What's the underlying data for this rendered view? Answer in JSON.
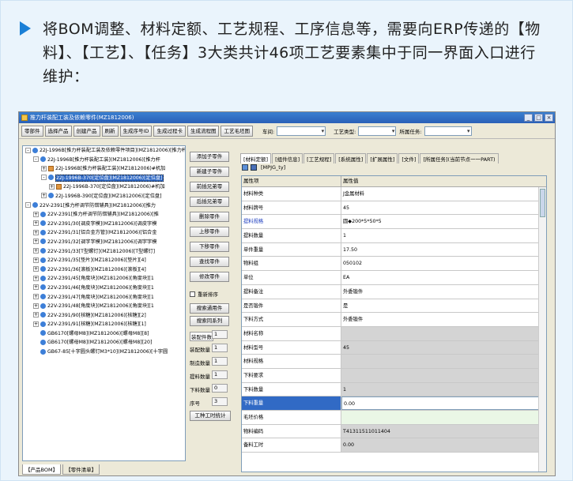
{
  "intro": {
    "text": "将BOM调整、材料定额、工艺规程、工序信息等，需要向ERP传递的【物料】、【工艺】、【任务】3大类共计46项工艺要素集中于同一界面入口进行维护："
  },
  "window": {
    "title": "推力杆装配工装及依赖零件(MZ1812006)",
    "controls": [
      "_",
      "□",
      "×"
    ]
  },
  "toolbar": {
    "buttons": [
      "零部件",
      "选择产品",
      "创建产品",
      "刷新",
      "生成序号ID",
      "生成过程卡",
      "生成流程图",
      "工艺毛坯图"
    ],
    "workshop_label": "车间:",
    "workshop_value": "",
    "process_type_label": "工艺类型:",
    "process_type_value": "",
    "task_label": "所属任务:",
    "task_value": ""
  },
  "tree": {
    "nodes": [
      {
        "text": "22J-1996B[推力杆装配工装及依赖零件项目](MZ1812006)[推力杆",
        "level": 0,
        "icon": "node",
        "exp": "-"
      },
      {
        "text": "22J-1996B[推力杆装配工装](MZ1812006)[推力杆",
        "level": 1,
        "icon": "node",
        "exp": "-"
      },
      {
        "text": "22J-1996B[推力杆装配工装](MZ1812006)#机加",
        "level": 2,
        "icon": "pkg",
        "exp": "+"
      },
      {
        "text": "22J-1996B-370[定位盘](MZ1812006)[定位盘]",
        "level": 2,
        "icon": "node",
        "exp": "-",
        "selected": true
      },
      {
        "text": "22J-1996B-370[定位盘](MZ1812006)#机加",
        "level": 3,
        "icon": "pkg",
        "exp": "+"
      },
      {
        "text": "22J-1996B-390[定位盘](MZ1812006)[定位盘]",
        "level": 2,
        "icon": "node",
        "exp": "+"
      },
      {
        "text": "22V-2391[推力杆调节防错辅具](MZ1812006)[推力",
        "level": 0,
        "icon": "node",
        "exp": "-"
      },
      {
        "text": "22V-2391[推力杆调节防错辅具](MZ1812006)[推",
        "level": 1,
        "icon": "node",
        "exp": "+"
      },
      {
        "text": "22V-2391/30[调皮字模](MZ1812006)[调皮字模",
        "level": 1,
        "icon": "node",
        "exp": "+"
      },
      {
        "text": "22V-2391/31[铝合金方管](MZ1812006)[铝合金",
        "level": 1,
        "icon": "node",
        "exp": "+"
      },
      {
        "text": "22V-2391/32[调字字模](MZ1812006)[调字字模",
        "level": 1,
        "icon": "node",
        "exp": "+"
      },
      {
        "text": "22V-2391/33[T型螺钉](MZ1812006)[T型螺钉]",
        "level": 1,
        "icon": "node",
        "exp": "+"
      },
      {
        "text": "22V-2391/35[垫片](MZ1812006)[垫片][4]",
        "level": 1,
        "icon": "node",
        "exp": "+"
      },
      {
        "text": "22V-2391/36[滚板](MZ1812006)[滚板][4]",
        "level": 1,
        "icon": "node",
        "exp": "+"
      },
      {
        "text": "22V-2391/45[角度块](MZ1812006)[角度块][1",
        "level": 1,
        "icon": "node",
        "exp": "+"
      },
      {
        "text": "22V-2391/46[角度块](MZ1812006)[角度块][1",
        "level": 1,
        "icon": "node",
        "exp": "+"
      },
      {
        "text": "22V-2391/47[角度块](MZ1812006)[角度块][1",
        "level": 1,
        "icon": "node",
        "exp": "+"
      },
      {
        "text": "22V-2391/48[角度块](MZ1812006)[角度块][1",
        "level": 1,
        "icon": "node",
        "exp": "+"
      },
      {
        "text": "22V-2391/90[核糖](MZ1812006)[核糖][2]",
        "level": 1,
        "icon": "node",
        "exp": "+"
      },
      {
        "text": "22V-2391/91[核糖](MZ1812006)[核糖][1]",
        "level": 1,
        "icon": "node",
        "exp": "+"
      },
      {
        "text": "GB6170[螺母M8](MZ1812006)[螺母M8][8]",
        "level": 1,
        "icon": "node",
        "exp": ""
      },
      {
        "text": "GB6170[螺母M8](MZ1812006)[螺母M8][20]",
        "level": 1,
        "icon": "node",
        "exp": ""
      },
      {
        "text": "GB67-85[十字圆头螺钉M3*10](MZ1812006)[十字圆",
        "level": 1,
        "icon": "node",
        "exp": ""
      }
    ]
  },
  "bottom_tabs": [
    "【产品BOM】",
    "【零件清单】"
  ],
  "mid_panel": {
    "buttons": [
      "添加子零件",
      "新建子零件",
      "前插兄弟零",
      "后插兄弟零",
      "删除零件",
      "上移零件",
      "下移零件",
      "查找零件",
      "修改零件"
    ],
    "checkbox_label": "重新排序",
    "buttons2": [
      "搜索通用件",
      "搜索同系列"
    ],
    "fields": [
      {
        "label": "装配件数",
        "value": "1"
      },
      {
        "label": "装配数量",
        "value": "1"
      },
      {
        "label": "制造数量",
        "value": "1"
      },
      {
        "label": "提料数量",
        "value": "1"
      },
      {
        "label": "下料数量",
        "value": "0"
      },
      {
        "label": "序号",
        "value": "3"
      }
    ],
    "bottom_button": "工种工时统计"
  },
  "right_tabs": [
    "[材料定额]",
    "[组件信息]",
    "[工艺规程]",
    "[系统属性]",
    "[扩展属性]",
    "[文件]",
    "[所属任务](当前节点一一PART)"
  ],
  "right_toolbar_label": "[MPJG_ty]",
  "grid": {
    "headers": [
      "属性项",
      "属性值"
    ],
    "rows": [
      {
        "k": "材料种类",
        "v": "J金属材料",
        "style": ""
      },
      {
        "k": "材料牌号",
        "v": "45",
        "style": ""
      },
      {
        "k": "提料规格",
        "v": "圆◆200*5*50*5",
        "style": "blue"
      },
      {
        "k": "提料数量",
        "v": "1",
        "style": ""
      },
      {
        "k": "单件重量",
        "v": "17.50",
        "style": ""
      },
      {
        "k": "物料组",
        "v": "050102",
        "style": ""
      },
      {
        "k": "单位",
        "v": "EA",
        "style": ""
      },
      {
        "k": "提料备注",
        "v": "外委锻件",
        "style": ""
      },
      {
        "k": "是否锻件",
        "v": "是",
        "style": ""
      },
      {
        "k": "下料方式",
        "v": "外委锻件",
        "style": ""
      },
      {
        "k": "材料名称",
        "v": "",
        "style": "gray"
      },
      {
        "k": "材料型号",
        "v": "45",
        "style": "gray"
      },
      {
        "k": "材料规格",
        "v": "",
        "style": "gray"
      },
      {
        "k": "下料要求",
        "v": "",
        "style": "gray"
      },
      {
        "k": "下料数量",
        "v": "1",
        "style": "gray"
      },
      {
        "k": "下料重量",
        "v": "0.00",
        "style": "hl"
      },
      {
        "k": "毛坯价格",
        "v": "",
        "style": "green"
      },
      {
        "k": "物料编码",
        "v": "T41311511011404",
        "style": "gray"
      },
      {
        "k": "备料工时",
        "v": "0.00",
        "style": "gray"
      }
    ]
  }
}
